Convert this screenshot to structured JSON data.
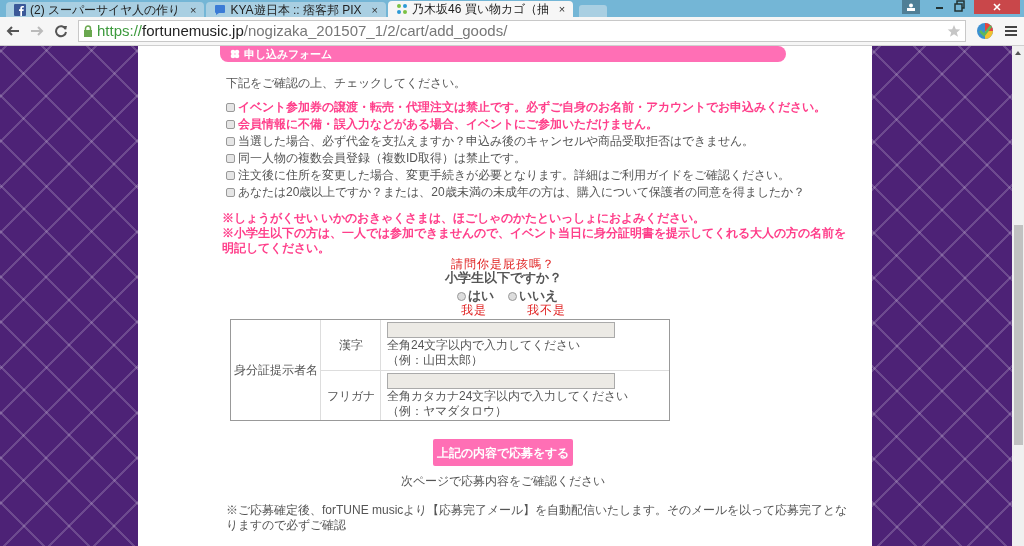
{
  "browser": {
    "tabs": [
      {
        "title": "(2) スーパーサイヤ人の作り",
        "kind": "facebook",
        "selected": false,
        "close": "×"
      },
      {
        "title": "KYA遊日本 :: 痞客邦 PIX",
        "kind": "chat",
        "selected": false,
        "close": "×"
      },
      {
        "title": "乃木坂46 買い物カゴ（抽",
        "kind": "site",
        "selected": true,
        "close": "×"
      }
    ],
    "url": {
      "scheme": "https://",
      "host": "fortunemusic.jp",
      "path": "/nogizaka_201507_1/2/cart/add_goods/"
    }
  },
  "form": {
    "heading": "申し込みフォーム",
    "intro": "下記をご確認の上、チェックしてください。",
    "checks": [
      {
        "label": "イベント参加券の譲渡・転売・代理注文は禁止です。必ずご自身のお名前・アカウントでお申込みください。",
        "important": true,
        "checked": false
      },
      {
        "label": "会員情報に不備・誤入力などがある場合、イベントにご参加いただけません。",
        "important": true,
        "checked": false
      },
      {
        "label": "当選した場合、必ず代金を支払えますか？申込み後のキャンセルや商品受取拒否はできません。",
        "important": false,
        "checked": false
      },
      {
        "label": "同一人物の複数会員登録（複数ID取得）は禁止です。",
        "important": false,
        "checked": false
      },
      {
        "label": "注文後に住所を変更した場合、変更手続きが必要となります。詳細はご利用ガイドをご確認ください。",
        "important": false,
        "checked": false
      },
      {
        "label": "あなたは20歳以上ですか？または、20歳未満の未成年の方は、購入について保護者の同意を得ましたか？",
        "important": false,
        "checked": false
      }
    ],
    "notes": [
      "※しょうがくせい いかのおきゃくさまは、ほごしゃのかたといっしょにおよみください。",
      "※小学生以下の方は、一人では参加できませんので、イベント当日に身分証明書を提示してくれる大人の方の名前を明記してください。"
    ],
    "annotation_top": "請問你是屁孩嗎？",
    "question": "小学生以下ですか？",
    "options": [
      {
        "label": "はい",
        "selected": false,
        "annotation": "我是"
      },
      {
        "label": "いいえ",
        "selected": false,
        "annotation": "我不是"
      }
    ],
    "table": {
      "group_label": "身分証提示者名",
      "rows": [
        {
          "label": "漢字",
          "hint": "全角24文字以内で入力してください",
          "example": "（例：山田太郎）"
        },
        {
          "label": "フリガナ",
          "hint": "全角カタカナ24文字以内で入力してください",
          "example": "（例：ヤマダタロウ）"
        }
      ]
    },
    "submit": "上記の内容で応募をする",
    "submit_note": "次ページで応募内容をご確認ください",
    "footnote": "※ご応募確定後、forTUNE musicより【応募完了メール】を自動配信いたします。そのメールを以って応募完了となりますので必ずご確認"
  }
}
